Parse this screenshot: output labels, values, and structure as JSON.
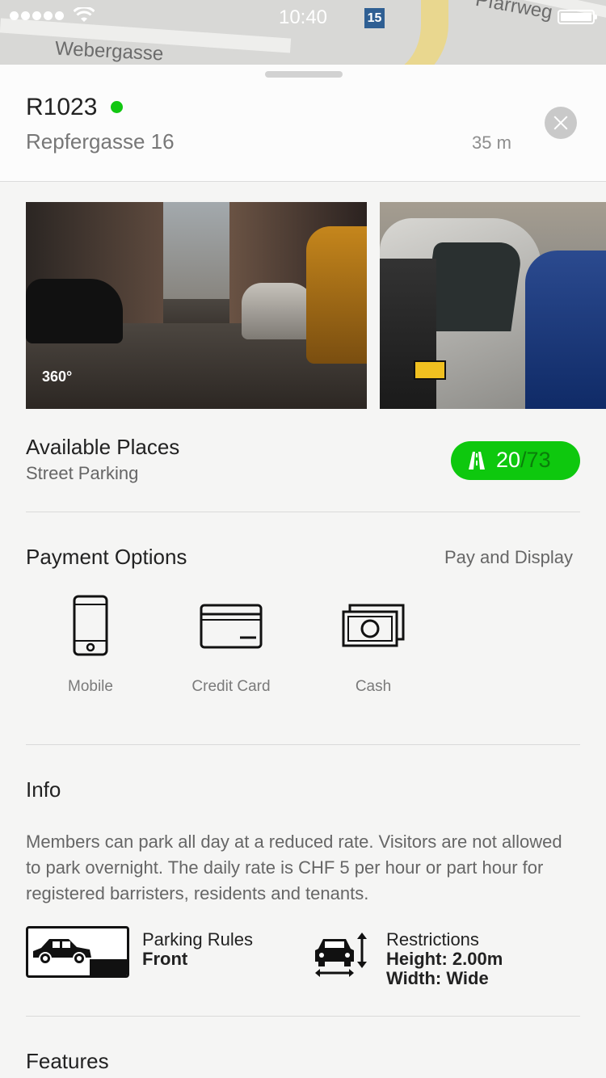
{
  "status_bar": {
    "time": "10:40"
  },
  "map": {
    "street_left": "Webergasse",
    "street_right": "Pfarrweg",
    "route_shield": "15"
  },
  "spot": {
    "id": "R1023",
    "address": "Repfergasse 16",
    "distance": "35 m",
    "online_color": "#12c712"
  },
  "photos": {
    "first_badge": "360°"
  },
  "availability": {
    "title": "Available Places",
    "subtitle": "Street Parking",
    "available": "20",
    "total": "/73",
    "accent_color": "#0ec80e"
  },
  "payment": {
    "title": "Payment Options",
    "method": "Pay and Display",
    "options": [
      {
        "label": "Mobile",
        "icon": "mobile-phone-icon"
      },
      {
        "label": "Credit Card",
        "icon": "credit-card-icon"
      },
      {
        "label": "Cash",
        "icon": "cash-icon"
      }
    ]
  },
  "info": {
    "title": "Info",
    "text": "Members can park all day at a reduced rate. Visitors are not allowed to park overnight. The daily rate is CHF 5 per hour or part hour for registered barristers, residents and tenants.",
    "parking_rules": {
      "title": "Parking Rules",
      "value": "Front",
      "icon": "front-parking-icon"
    },
    "restrictions": {
      "title": "Restrictions",
      "height": "Height: 2.00m",
      "width": "Width: Wide",
      "icon": "vehicle-dimensions-icon"
    }
  },
  "features": {
    "title": "Features"
  }
}
